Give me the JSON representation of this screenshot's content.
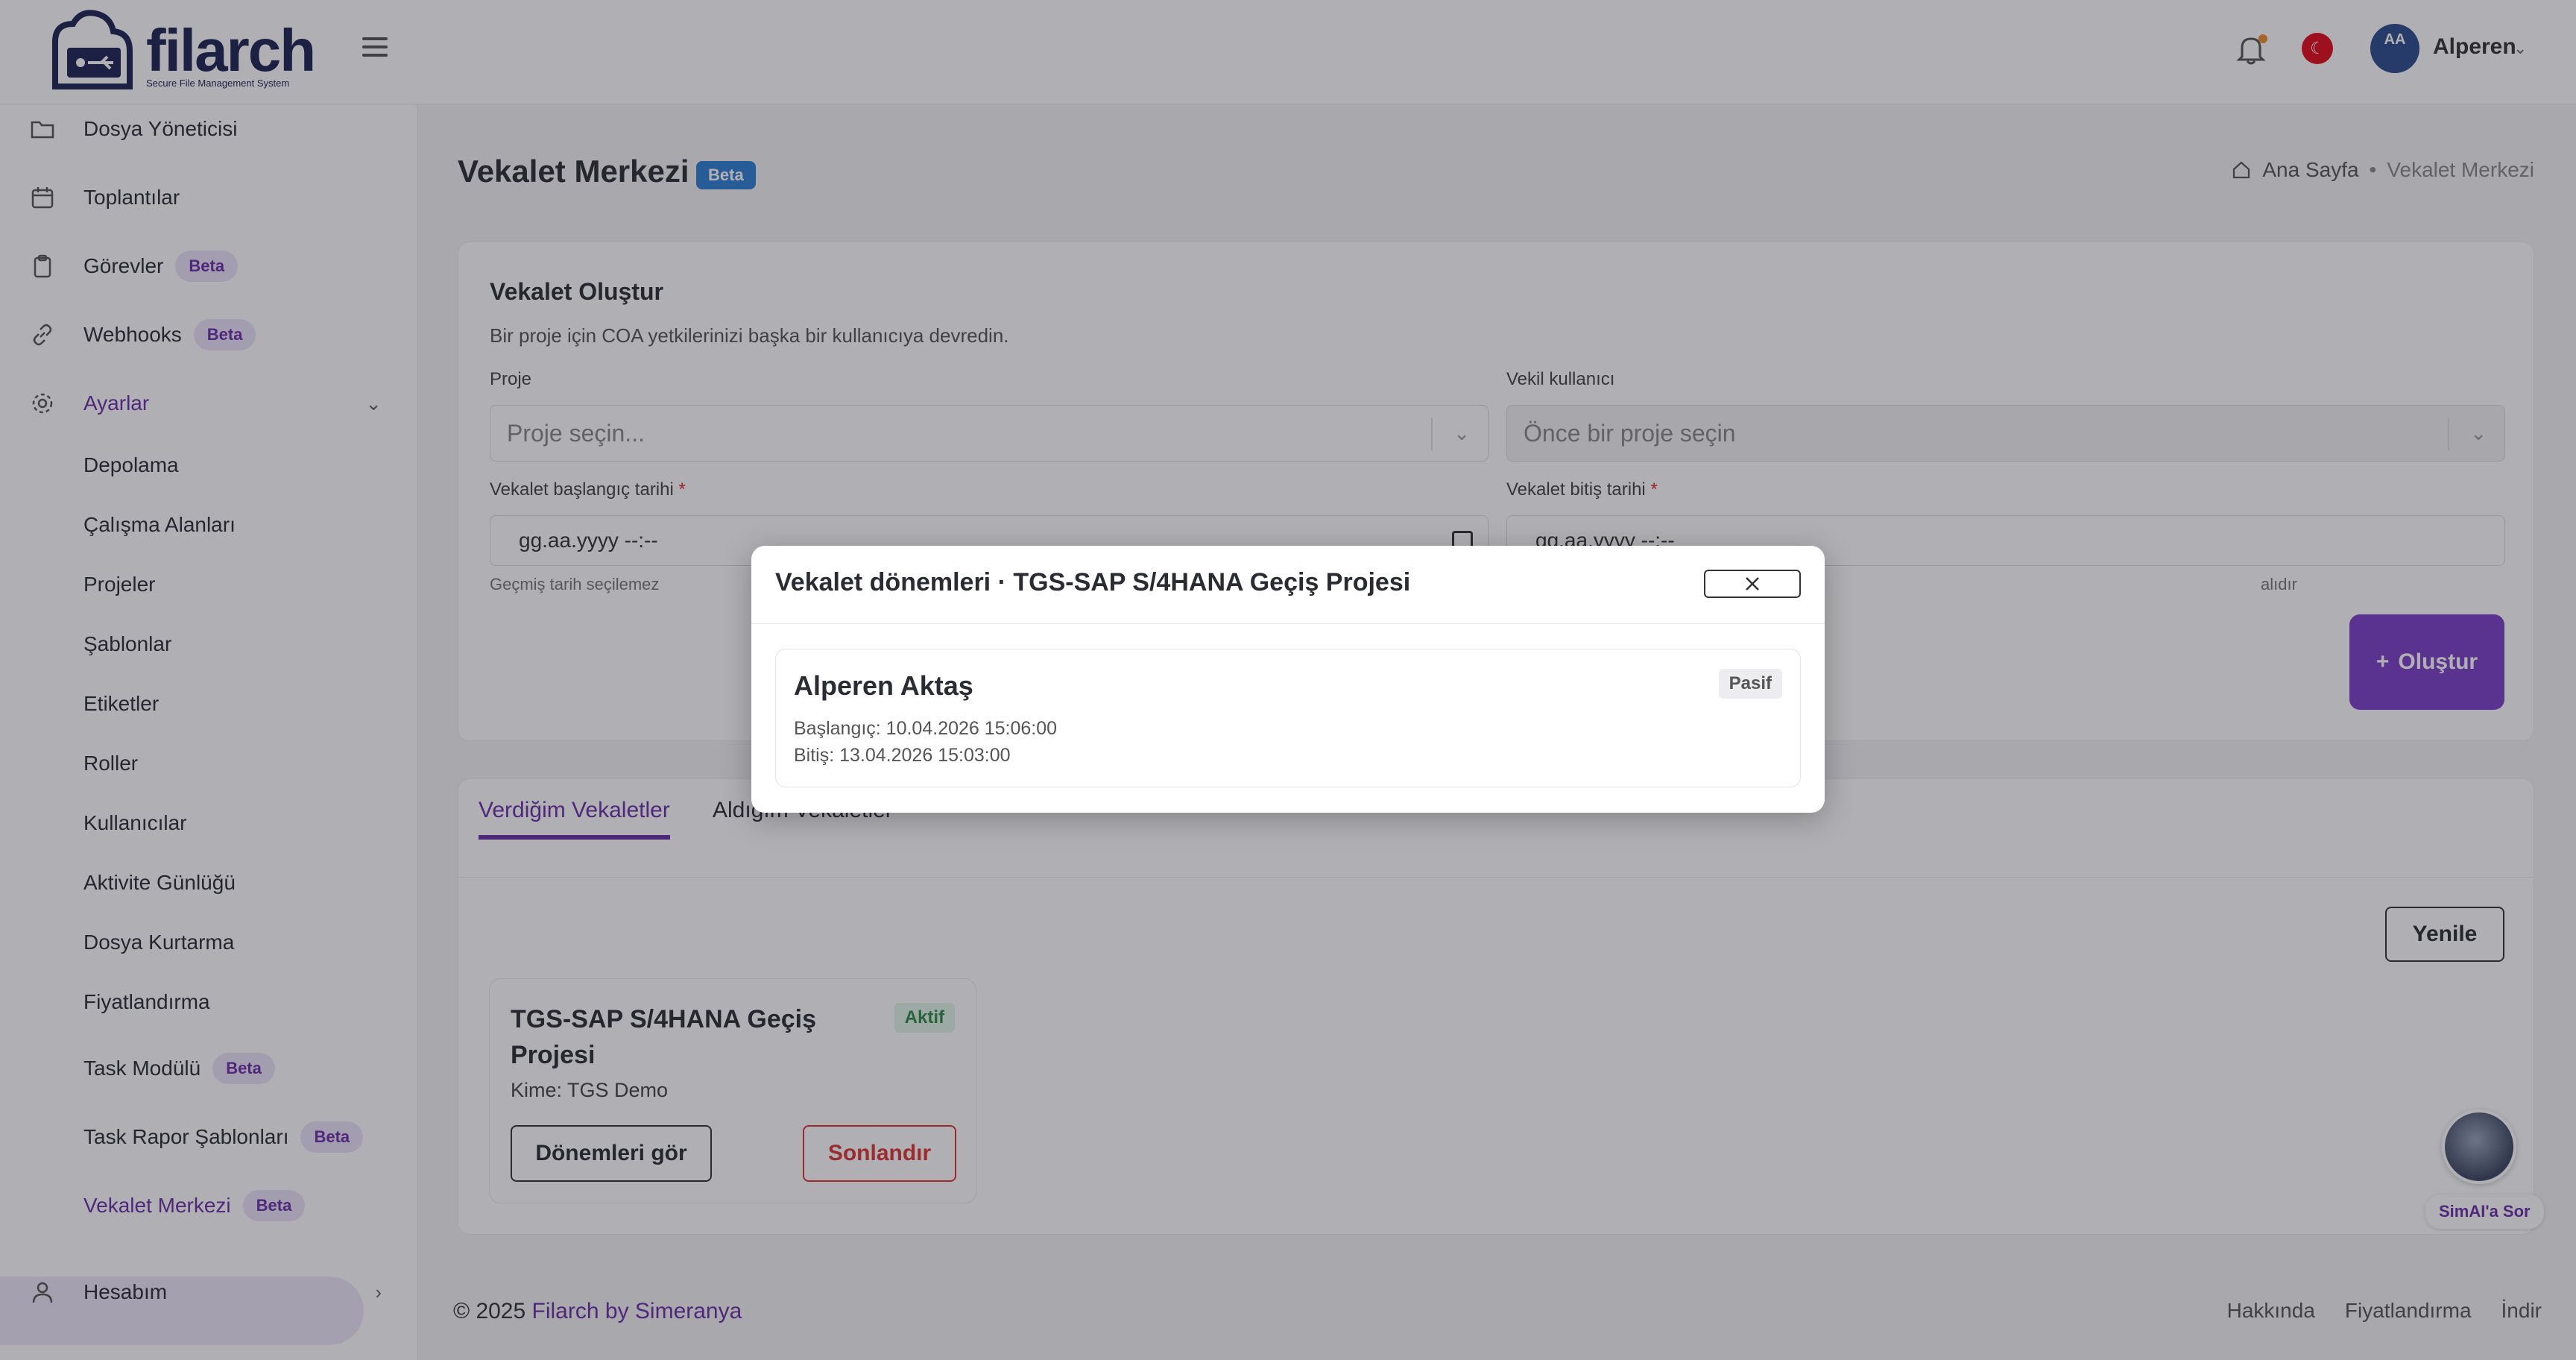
{
  "app": {
    "logo_text": "filarch",
    "logo_sub": "Secure File Management System"
  },
  "header": {
    "user_initials": "AA",
    "user_name": "Alperen",
    "flag": "tr-flag"
  },
  "sidebar": {
    "items": [
      {
        "label": "Dosya Yöneticisi",
        "icon": "folder-icon"
      },
      {
        "label": "Toplantılar",
        "icon": "calendar-icon"
      },
      {
        "label": "Görevler",
        "icon": "clipboard-icon",
        "badge": "Beta"
      },
      {
        "label": "Webhooks",
        "icon": "link-icon",
        "badge": "Beta"
      },
      {
        "label": "Ayarlar",
        "icon": "gear-icon"
      }
    ],
    "sub_items": [
      {
        "label": "Depolama"
      },
      {
        "label": "Çalışma Alanları"
      },
      {
        "label": "Projeler"
      },
      {
        "label": "Şablonlar"
      },
      {
        "label": "Etiketler"
      },
      {
        "label": "Roller"
      },
      {
        "label": "Kullanıcılar"
      },
      {
        "label": "Aktivite Günlüğü"
      },
      {
        "label": "Dosya Kurtarma"
      },
      {
        "label": "Fiyatlandırma"
      },
      {
        "label": "Task Modülü",
        "badge": "Beta"
      },
      {
        "label": "Task Rapor Şablonları",
        "badge": "Beta"
      },
      {
        "label": "Vekalet Merkezi",
        "badge": "Beta"
      }
    ],
    "account_label": "Hesabım"
  },
  "page": {
    "title": "Vekalet Merkezi",
    "title_badge": "Beta",
    "breadcrumb_home": "Ana Sayfa",
    "breadcrumb_sep": "•",
    "breadcrumb_current": "Vekalet Merkezi"
  },
  "create_form": {
    "title": "Vekalet Oluştur",
    "description": "Bir proje için COA yetkilerinizi başka bir kullanıcıya devredin.",
    "project_label": "Proje",
    "project_placeholder": "Proje seçin...",
    "delegate_label": "Vekil kullanıcı",
    "delegate_placeholder": "Önce bir proje seçin",
    "start_label": "Vekalet başlangıç tarihi",
    "start_value": "gg.aa.yyyy --:--",
    "start_hint": "Geçmiş tarih seçilemez",
    "end_label": "Vekalet bitiş tarihi",
    "end_value": "gg.aa.yyyy --:--",
    "end_hint": "alıdır",
    "required_mark": "*",
    "submit_label": "Oluştur"
  },
  "tabs": [
    {
      "label": "Verdiğim Vekaletler",
      "active": true
    },
    {
      "label": "Aldığım Vekaletler",
      "active": false
    }
  ],
  "list": {
    "refresh_label": "Yenile",
    "card": {
      "title": "TGS-SAP S/4HANA Geçiş Projesi",
      "status": "Aktif",
      "to": "Kime: TGS Demo",
      "periods_button": "Dönemleri gör",
      "end_button": "Sonlandır"
    }
  },
  "footer": {
    "copyright": "© 2025",
    "brand_link": "Filarch by Simeranya",
    "links": [
      "Hakkında",
      "Fiyatlandırma",
      "İndir"
    ]
  },
  "assistant": {
    "label": "SimAI'a Sor"
  },
  "modal": {
    "title": "Vekalet dönemleri · TGS-SAP S/4HANA Geçiş Projesi",
    "period": {
      "name": "Alperen Aktaş",
      "status": "Pasif",
      "start": "Başlangıç: 10.04.2026 15:06:00",
      "end": "Bitiş: 13.04.2026 15:03:00"
    }
  },
  "colors": {
    "accent": "#6b2fa8",
    "primary_button": "#7a3fc7",
    "danger": "#d33333",
    "active_green": "#2e8b45"
  }
}
